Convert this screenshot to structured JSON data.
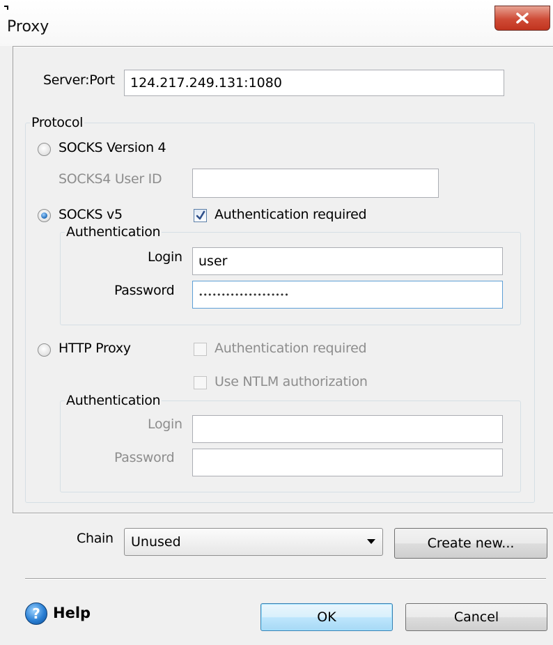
{
  "window": {
    "title": "Proxy"
  },
  "server": {
    "label": "Server:Port",
    "value": "124.217.249.131:1080"
  },
  "protocol": {
    "legend": "Protocol",
    "socks4": {
      "label": "SOCKS Version 4",
      "user_id_label": "SOCKS4 User ID",
      "user_id_value": ""
    },
    "socks5": {
      "label": "SOCKS v5",
      "auth_required_label": "Authentication required",
      "auth_legend": "Authentication",
      "login_label": "Login",
      "login_value": "user",
      "password_label": "Password",
      "password_value": "••••••••••••••••••••"
    },
    "http": {
      "label": "HTTP Proxy",
      "auth_required_label": "Authentication required",
      "ntlm_label": "Use NTLM authorization",
      "auth_legend": "Authentication",
      "login_label": "Login",
      "login_value": "",
      "password_label": "Password",
      "password_value": ""
    }
  },
  "chain": {
    "label": "Chain",
    "selected": "Unused",
    "create_label": "Create new..."
  },
  "footer": {
    "help_label": "Help",
    "ok_label": "OK",
    "cancel_label": "Cancel"
  },
  "state": {
    "selected_protocol": "SOCKS v5",
    "socks5_auth_checked": true,
    "http_auth_checked": false,
    "ntlm_checked": false
  },
  "colors": {
    "close_button": "#c8402b",
    "focus_border": "#5d9fd6",
    "default_button": "#bee6fd"
  }
}
